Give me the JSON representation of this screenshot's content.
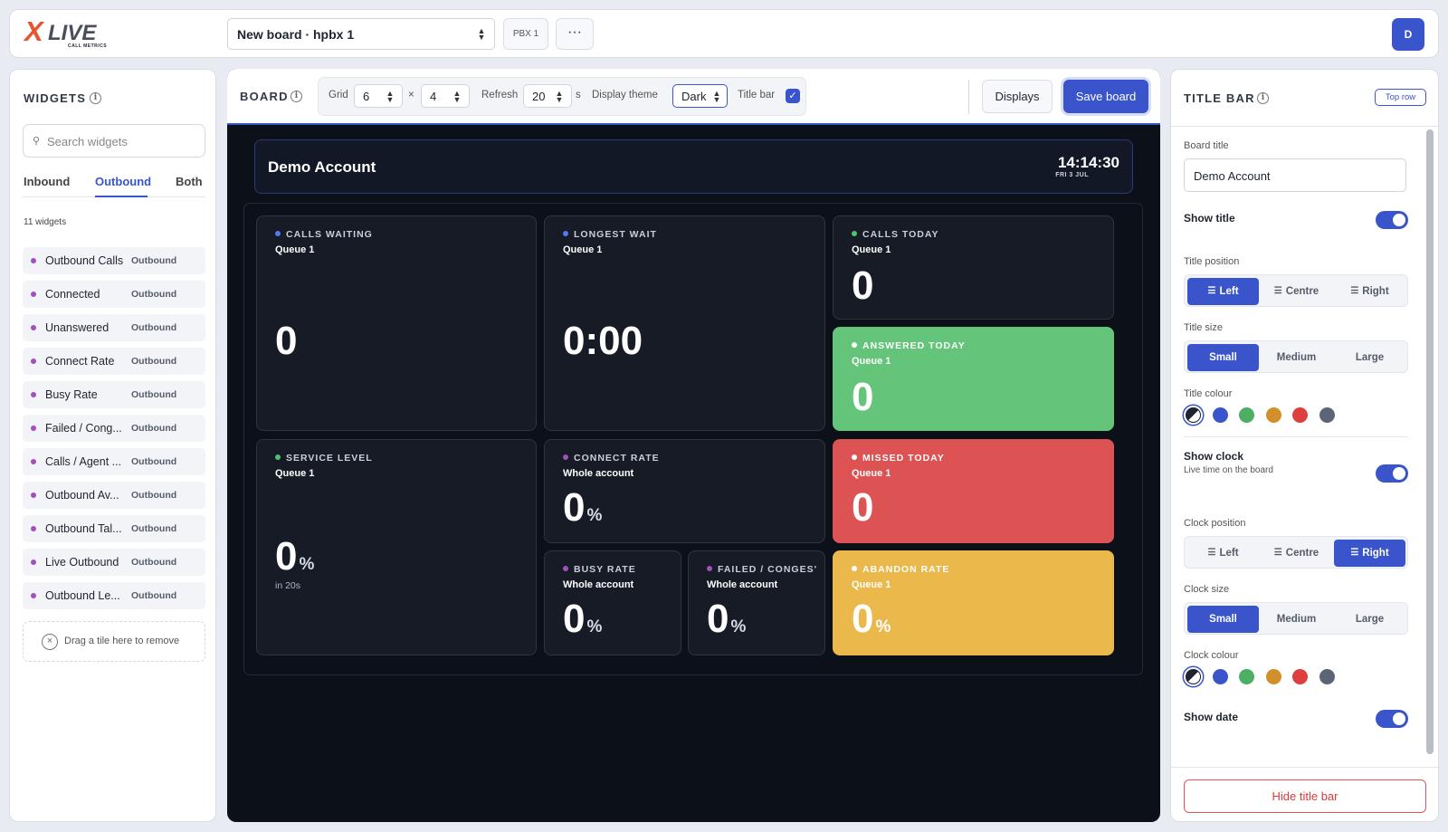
{
  "app": {
    "logo_x": "X",
    "logo_live": "LIVE",
    "logo_sub": "CALL METRICS",
    "board_select": "New board · hpbx 1",
    "pbx_label": "PBX 1",
    "more_label": "···",
    "avatar_initial": "D"
  },
  "widgets": {
    "title": "WIDGETS",
    "search_placeholder": "Search widgets",
    "tabs": [
      "Inbound",
      "Outbound",
      "Both"
    ],
    "active_tab": "Outbound",
    "count_label": "11 widgets",
    "items": [
      {
        "name": "Outbound Calls",
        "tag": "Outbound"
      },
      {
        "name": "Connected",
        "tag": "Outbound"
      },
      {
        "name": "Unanswered",
        "tag": "Outbound"
      },
      {
        "name": "Connect Rate",
        "tag": "Outbound"
      },
      {
        "name": "Busy Rate",
        "tag": "Outbound"
      },
      {
        "name": "Failed / Cong...",
        "tag": "Outbound"
      },
      {
        "name": "Calls / Agent ...",
        "tag": "Outbound"
      },
      {
        "name": "Outbound Av...",
        "tag": "Outbound"
      },
      {
        "name": "Outbound Tal...",
        "tag": "Outbound"
      },
      {
        "name": "Live Outbound",
        "tag": "Outbound"
      },
      {
        "name": "Outbound Le...",
        "tag": "Outbound"
      }
    ],
    "drop_text": "Drag a tile here to remove",
    "item_dot_color": "#a34fbf"
  },
  "board": {
    "title": "BOARD",
    "grid_label": "Grid",
    "grid_cols": "6",
    "grid_x": "×",
    "grid_rows": "4",
    "refresh_label": "Refresh",
    "refresh_value": "20",
    "refresh_unit": "s",
    "theme_label": "Display theme",
    "theme_value": "Dark",
    "titlebar_label": "Title bar",
    "titlebar_checked": true,
    "displays_label": "Displays",
    "save_label": "Save board",
    "accent": "#3a55cc"
  },
  "display": {
    "title": "Demo Account",
    "clock": "14:14:30",
    "date": "FRI 3 JUL",
    "tiles": [
      {
        "label": "CALLS WAITING",
        "sub": "Queue 1",
        "value": "0",
        "unit": "",
        "color": "dark",
        "dot": "#4f7df0"
      },
      {
        "label": "LONGEST WAIT",
        "sub": "Queue 1",
        "value": "0:00",
        "unit": "",
        "color": "dark",
        "dot": "#4f7df0"
      },
      {
        "label": "CALLS TODAY",
        "sub": "Queue 1",
        "value": "0",
        "unit": "",
        "color": "dark",
        "dot": "#4cc36a"
      },
      {
        "label": "ANSWERED TODAY",
        "sub": "Queue 1",
        "value": "0",
        "unit": "",
        "color": "green",
        "dot": "#ffffff"
      },
      {
        "label": "SERVICE LEVEL",
        "sub": "Queue 1",
        "value": "0",
        "unit": "%",
        "note": "in 20s",
        "color": "dark",
        "dot": "#4cc36a"
      },
      {
        "label": "CONNECT RATE",
        "sub": "Whole account",
        "value": "0",
        "unit": "%",
        "color": "dark",
        "dot": "#a34fbf"
      },
      {
        "label": "MISSED TODAY",
        "sub": "Queue 1",
        "value": "0",
        "unit": "",
        "color": "red",
        "dot": "#ffffff"
      },
      {
        "label": "BUSY RATE",
        "sub": "Whole account",
        "value": "0",
        "unit": "%",
        "color": "dark",
        "dot": "#a34fbf"
      },
      {
        "label": "FAILED / CONGES'",
        "sub": "Whole account",
        "value": "0",
        "unit": "%",
        "color": "dark",
        "dot": "#a34fbf"
      },
      {
        "label": "ABANDON RATE",
        "sub": "Queue 1",
        "value": "0",
        "unit": "%",
        "color": "amber",
        "dot": "#ffffff"
      }
    ]
  },
  "settings": {
    "title": "TITLE BAR",
    "badge": "Top row",
    "board_title_label": "Board title",
    "board_title_value": "Demo Account",
    "show_title_label": "Show title",
    "show_title_on": true,
    "title_position_label": "Title position",
    "title_position_options": [
      "Left",
      "Centre",
      "Right"
    ],
    "title_position_selected": "Left",
    "title_size_label": "Title size",
    "title_size_options": [
      "Small",
      "Medium",
      "Large"
    ],
    "title_size_selected": "Small",
    "title_colour_label": "Title colour",
    "colour_options": [
      "#1f2430",
      "#3a55cc",
      "#4caf63",
      "#d1902c",
      "#dd3f3f",
      "#5c6577"
    ],
    "show_clock_label": "Show clock",
    "show_clock_hint": "Live time on the board",
    "show_clock_on": true,
    "clock_position_label": "Clock position",
    "clock_position_options": [
      "Left",
      "Centre",
      "Right"
    ],
    "clock_position_selected": "Right",
    "clock_size_label": "Clock size",
    "clock_size_options": [
      "Small",
      "Medium",
      "Large"
    ],
    "clock_size_selected": "Small",
    "clock_colour_label": "Clock colour",
    "show_date_label": "Show date",
    "show_date_on": true,
    "hide_button": "Hide title bar"
  }
}
